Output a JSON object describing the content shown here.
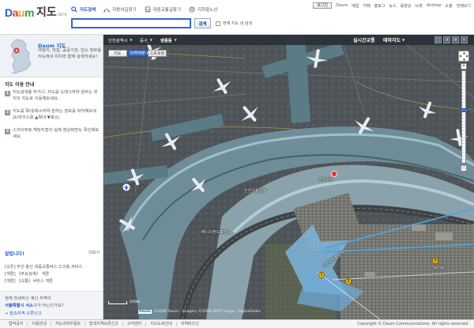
{
  "logo": {
    "d": "D",
    "a": "a",
    "u": "u",
    "m": "m",
    "service": "지도",
    "beta": "BETA"
  },
  "search": {
    "tabs": [
      {
        "label": "지도검색",
        "icon": "search-icon"
      },
      {
        "label": "자동차길찾기",
        "icon": "car-route-icon"
      },
      {
        "label": "대중교통길찾기",
        "icon": "bus-route-icon"
      },
      {
        "label": "지하철노선",
        "icon": "subway-icon"
      }
    ],
    "query": "",
    "button_label": "검색",
    "checkbox_label": "현재 지도 내 검색"
  },
  "topnav": [
    "로그인",
    "Daum",
    "메일",
    "카페",
    "블로그",
    "뉴스",
    "동영상",
    "tv팟",
    "dnshop",
    "쇼핑",
    "전체보기"
  ],
  "intro": {
    "title": "Daum 지도",
    "text": "여행지, 맛집, 공공기관, 업소 정보를 지도에서 위치와 함께 검색하세요!"
  },
  "guide": {
    "title": "지도 이용 안내",
    "steps": [
      {
        "num": "1",
        "text": "지도검색을 하거나, 지도를 드래그하여 원하는 위치의 지도로 이동해보세요."
      },
      {
        "num": "2",
        "text": "지도를 확대/축소하여 원하는 정보를 파악해보세요(마우스휠 ▲확대 ▼축소)"
      },
      {
        "num": "3",
        "text": "스카이뷰로 해당지점의 실제 영상화면도 확인해보세요."
      }
    ]
  },
  "notice": {
    "title": "알립니다!",
    "more": "더보기",
    "items": [
      "[오픈] 부산·울산 대중교통버스 스크롤 서비스",
      "[개편] 《주요검색》 개편",
      "[개편] 《교통》서비스 개편"
    ]
  },
  "mapverify": {
    "line1": "현재 전세하신 계신 지역이",
    "line2_hl": "서울특별시 서소",
    "line2_rest": "구가 아닌신가요?",
    "line3": "→ 접속지역 오류신고"
  },
  "map": {
    "regions": [
      "인천광역시",
      "중구",
      "영종동"
    ],
    "right_buttons": [
      "실시간교통",
      "테마지도"
    ],
    "icon_buttons": [
      "□",
      "↺",
      "✉",
      "✕"
    ],
    "types": [
      "지도",
      "스카이뷰",
      "스트릿뷰"
    ],
    "active_type": "스카이뷰",
    "labels": {
      "terminal": "인천국제공항",
      "hotel": "베니스랜드웨딩스",
      "station": "인천공항철도역",
      "poi_a": "인천공항",
      "parking": "주차장"
    },
    "scale": "100m",
    "copyright": "©2008 Daum - Imagery ©2008 SPOT Image · DigitalGlobe",
    "zoom_level_fraction": 0.42
  },
  "footer": {
    "links": [
      "법적공지",
      "이용안내",
      "지도의마우콩보",
      "탑색지역요류신고",
      "고객센터",
      "지도도로안내",
      "지역비즈신"
    ],
    "copyright": "Copyright © Daum Communications. All rights reserved."
  }
}
